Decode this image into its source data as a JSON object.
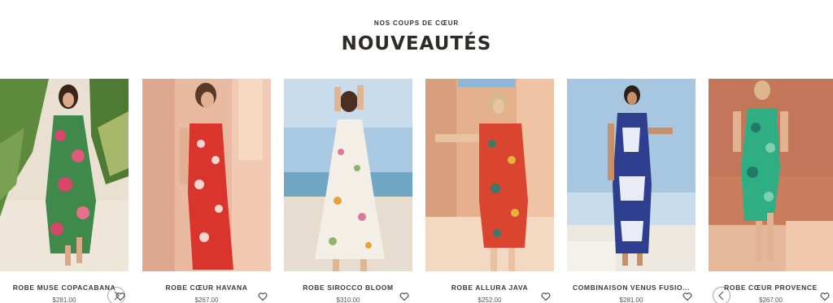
{
  "section": {
    "eyebrow": "NOS COUPS DE CŒUR",
    "title": "NOUVEAUTÉS"
  },
  "products": [
    {
      "name": "ROBE MUSE COPACABANA",
      "price": "$281.00",
      "wishlist_icon": "heart-icon"
    },
    {
      "name": "ROBE CŒUR HAVANA",
      "price": "$267.00",
      "wishlist_icon": "heart-icon"
    },
    {
      "name": "ROBE SIROCCO BLOOM",
      "price": "$310.00",
      "wishlist_icon": "heart-icon"
    },
    {
      "name": "ROBE ALLURA JAVA",
      "price": "$252.00",
      "wishlist_icon": "heart-icon"
    },
    {
      "name": "COMBINAISON VENUS FUSIO...",
      "price": "$281.00",
      "wishlist_icon": "heart-icon"
    },
    {
      "name": "ROBE CŒUR PROVENCE",
      "price": "$267.00",
      "wishlist_icon": "heart-icon"
    }
  ],
  "carousel": {
    "prev_icon": "chevron-left-icon",
    "next_icon": "chevron-right-icon"
  },
  "colors": {
    "title": "#2f2c27",
    "text": "#3a3a3a",
    "price": "#555555"
  }
}
